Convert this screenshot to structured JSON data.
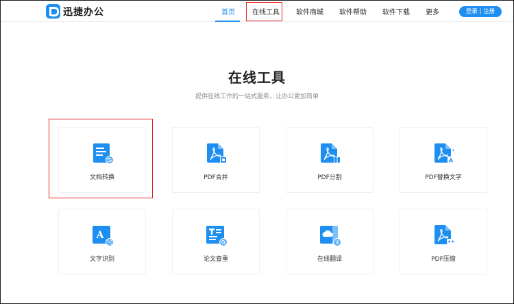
{
  "brand": {
    "name": "迅捷办公",
    "logo_icon": "p-logo-icon"
  },
  "nav": {
    "items": [
      {
        "label": "首页",
        "active": true
      },
      {
        "label": "在线工具",
        "active": false
      },
      {
        "label": "软件商城",
        "active": false
      },
      {
        "label": "软件帮助",
        "active": false
      },
      {
        "label": "软件下载",
        "active": false
      },
      {
        "label": "更多",
        "active": false
      }
    ],
    "login_label": "登录 | 注册"
  },
  "main": {
    "title": "在线工具",
    "subtitle": "提供在线工作的一站式服务，让办公更加简单",
    "tools": [
      {
        "label": "文档转换",
        "icon": "document-convert-icon"
      },
      {
        "label": "PDF合并",
        "icon": "pdf-merge-icon"
      },
      {
        "label": "PDF分割",
        "icon": "pdf-split-icon"
      },
      {
        "label": "PDF替换文字",
        "icon": "pdf-replace-text-icon"
      },
      {
        "label": "文字识别",
        "icon": "text-recognition-icon"
      },
      {
        "label": "论文查重",
        "icon": "paper-check-icon"
      },
      {
        "label": "在线翻译",
        "icon": "online-translate-icon"
      },
      {
        "label": "PDF压缩",
        "icon": "pdf-compress-icon"
      }
    ]
  },
  "colors": {
    "accent": "#1f8ef1",
    "highlight": "#e02020",
    "text": "#333333"
  }
}
